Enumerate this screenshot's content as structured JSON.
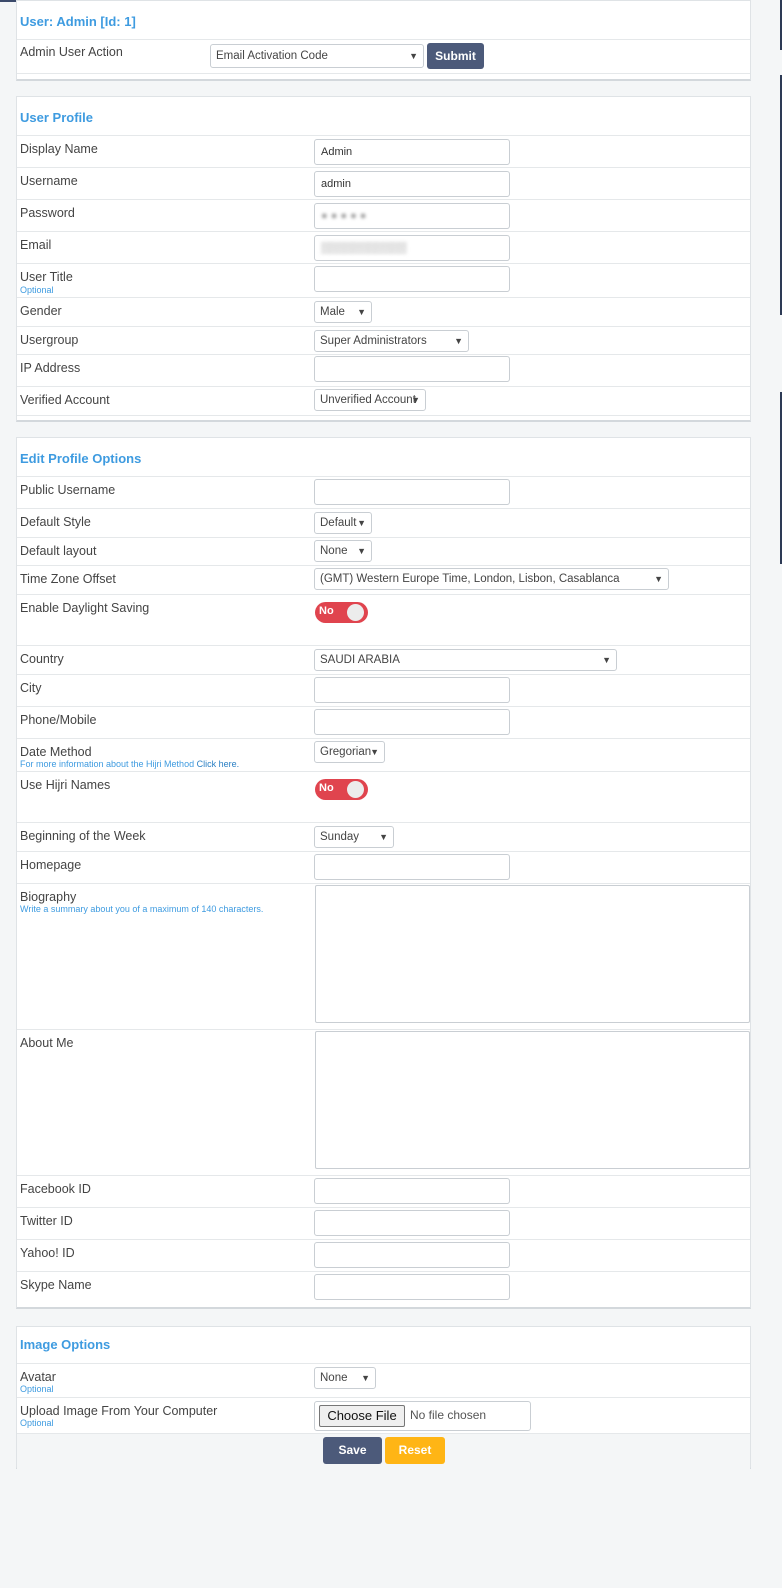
{
  "user_action": {
    "title": "User: Admin [Id: 1]",
    "label": "Admin User Action",
    "selected": "Email Activation Code",
    "submit": "Submit"
  },
  "profile": {
    "title": "User Profile",
    "display_name_label": "Display Name",
    "display_name": "Admin",
    "username_label": "Username",
    "username": "admin",
    "password_label": "Password",
    "email_label": "Email",
    "user_title_label": "User Title",
    "optional": "Optional",
    "gender_label": "Gender",
    "gender": "Male",
    "usergroup_label": "Usergroup",
    "usergroup": "Super Administrators",
    "ip_label": "IP Address",
    "verified_label": "Verified Account",
    "verified": "Unverified Account"
  },
  "edit": {
    "title": "Edit Profile Options",
    "public_username_label": "Public Username",
    "style_label": "Default Style",
    "style": "Default",
    "layout_label": "Default layout",
    "layout": "None",
    "tz_label": "Time Zone Offset",
    "tz": "(GMT) Western Europe Time, London, Lisbon, Casablanca",
    "dst_label": "Enable Daylight Saving",
    "dst": "No",
    "country_label": "Country",
    "country": "SAUDI ARABIA",
    "city_label": "City",
    "phone_label": "Phone/Mobile",
    "date_method_label": "Date Method",
    "date_method": "Gregorian",
    "hijri_info": "For more information about the Hijri Method",
    "click_here": "Click here.",
    "hijri_names_label": "Use Hijri Names",
    "hijri_names": "No",
    "week_label": "Beginning of the Week",
    "week": "Sunday",
    "homepage_label": "Homepage",
    "bio_label": "Biography",
    "bio_hint": "Write a summary about you of a maximum of 140 characters.",
    "about_label": "About Me",
    "facebook_label": "Facebook ID",
    "twitter_label": "Twitter ID",
    "yahoo_label": "Yahoo! ID",
    "skype_label": "Skype Name"
  },
  "image": {
    "title": "Image Options",
    "avatar_label": "Avatar",
    "avatar": "None",
    "optional": "Optional",
    "upload_label": "Upload Image From Your Computer",
    "choose_file": "Choose File",
    "no_file": "No file chosen",
    "save": "Save",
    "reset": "Reset"
  },
  "colors": {
    "accent": "#3e9be0",
    "primary_button": "#4c5a7a",
    "reset_button": "#ffb515",
    "toggle_off": "#e0444e"
  }
}
